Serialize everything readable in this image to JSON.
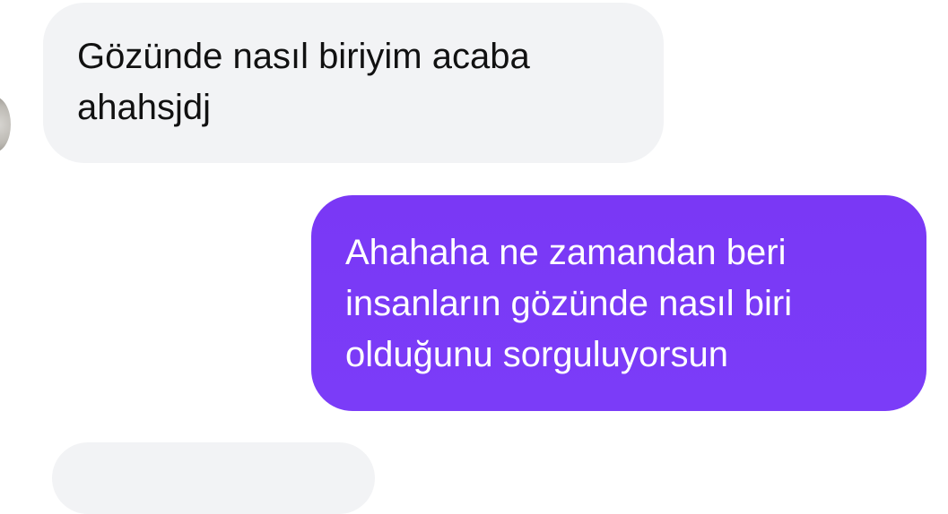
{
  "conversation": {
    "messages": [
      {
        "direction": "incoming",
        "text": "Gözünde nasıl biriyim acaba\nahahsjdj"
      },
      {
        "direction": "outgoing",
        "text": "Ahahaha ne zamandan beri\ninsanların gözünde nasıl biri\nolduğunu sorguluyorsun"
      }
    ]
  },
  "colors": {
    "incoming_bubble": "#f2f3f5",
    "outgoing_bubble": "#7a38f5",
    "incoming_text": "#111111",
    "outgoing_text": "#ffffff"
  }
}
